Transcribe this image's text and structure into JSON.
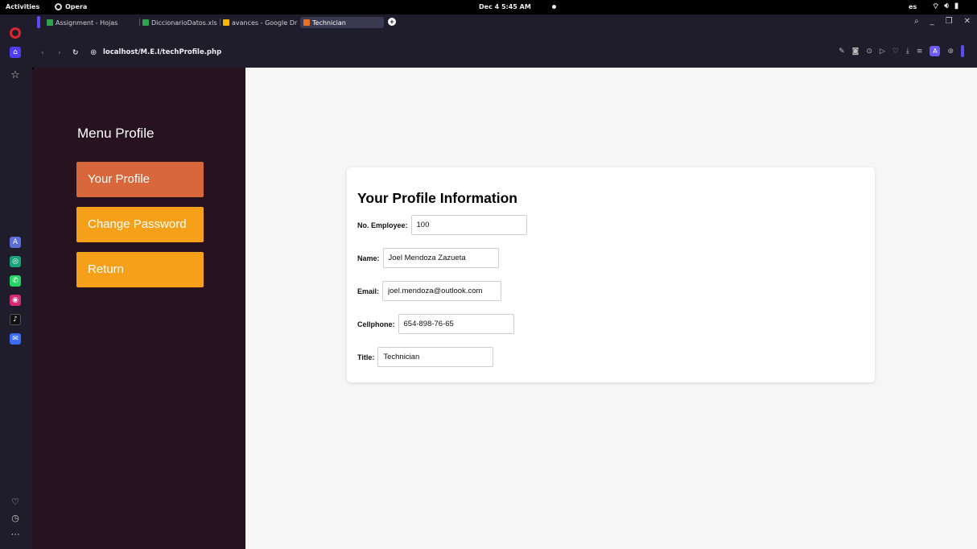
{
  "system_bar": {
    "activities": "Activities",
    "app_name": "Opera",
    "clock": "Dec 4  5:45 AM",
    "language": "es"
  },
  "tabs": [
    {
      "label": "Assignment - Hojas",
      "icon_color": "#2fa44f"
    },
    {
      "label": "DiccionarioDatos.xls",
      "icon_color": "#2fa44f"
    },
    {
      "label": "avances - Google Dr",
      "icon_color": "#f4b400"
    },
    {
      "label": "Technician",
      "icon_color": "#e8712a",
      "active": true
    }
  ],
  "address_bar": {
    "url": "localhost/M.E.I/techProfile.php"
  },
  "menu": {
    "title": "Menu Profile",
    "items": [
      {
        "label": "Your Profile"
      },
      {
        "label": "Change Password"
      },
      {
        "label": "Return"
      }
    ]
  },
  "profile": {
    "title": "Your Profile Information",
    "fields": {
      "employee": {
        "label": "No. Employee:",
        "value": "100"
      },
      "name": {
        "label": "Name:",
        "value": "Joel Mendoza Zazueta"
      },
      "email": {
        "label": "Email:",
        "value": "joel.mendoza@outlook.com"
      },
      "cellphone": {
        "label": "Cellphone:",
        "value": "654-898-76-65"
      },
      "title": {
        "label": "Title:",
        "value": "Technician"
      }
    }
  },
  "colors": {
    "menu_bg": "#27121f",
    "active_button": "#d8683b",
    "button": "#f6a019",
    "page_bg": "#f6f6f6"
  }
}
